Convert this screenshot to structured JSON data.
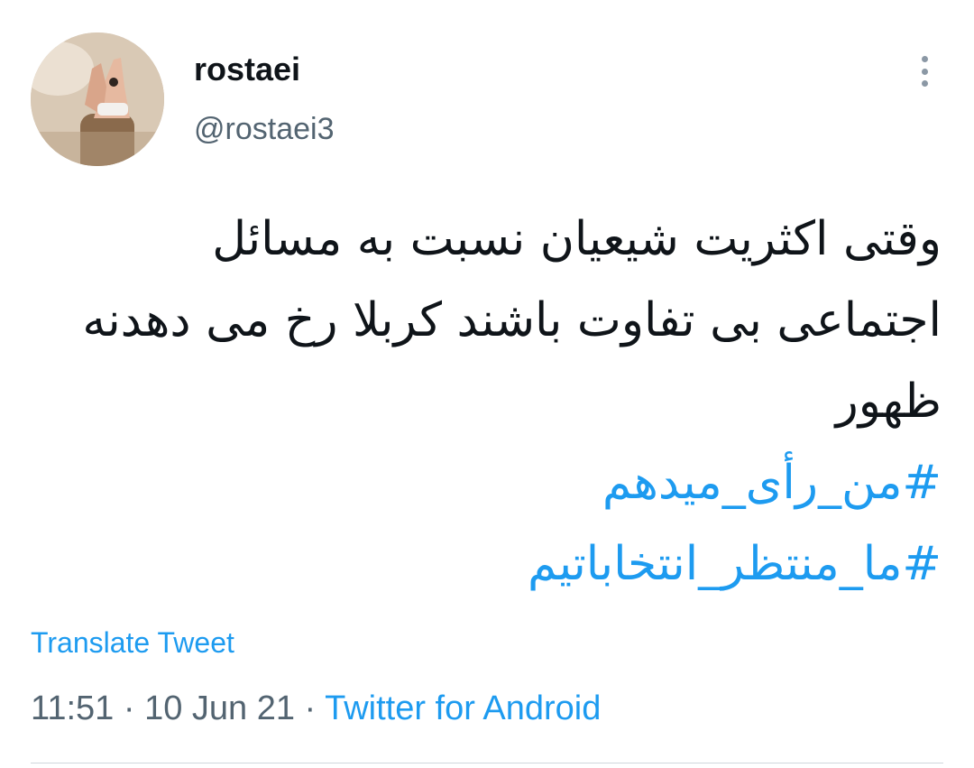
{
  "user": {
    "display_name": "rostaei",
    "handle": "@rostaei3"
  },
  "tweet": {
    "lines": [
      "وقتی اکثریت شیعیان نسبت به مسائل",
      "اجتماعی بی تفاوت باشند کربلا رخ می دهدنه",
      "ظهور"
    ],
    "hashtags": [
      "#من_رأی_میدهم",
      "#ما_منتظر_انتخاباتیم"
    ]
  },
  "actions": {
    "translate_label": "Translate Tweet"
  },
  "meta": {
    "time": "11:51",
    "separator": "·",
    "date": "10 Jun 21",
    "source": "Twitter for Android"
  },
  "icons": {
    "more": "more-vertical-icon"
  },
  "colors": {
    "link": "#1d9bf0",
    "text": "#0f1419",
    "secondary": "#536471"
  }
}
